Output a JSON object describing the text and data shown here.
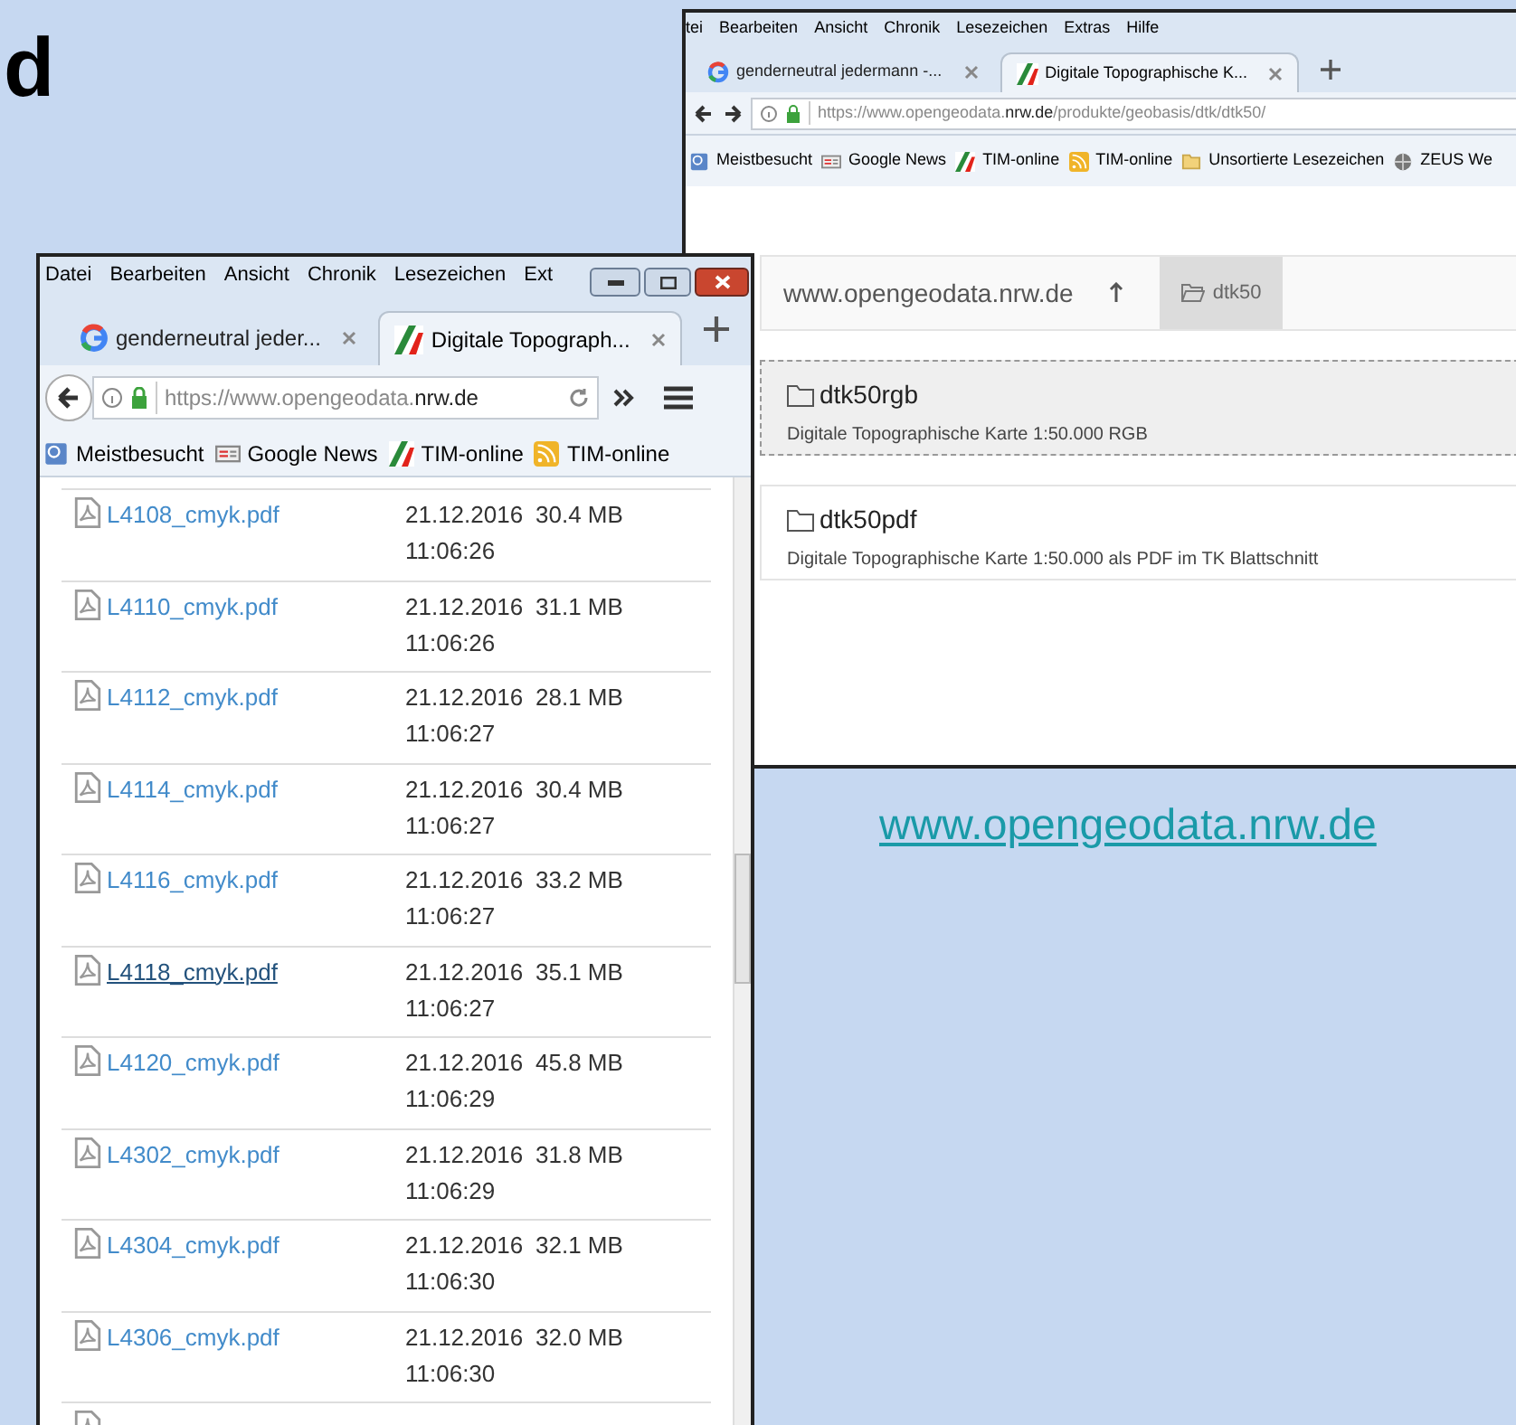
{
  "slide": {
    "title": "d",
    "link": "www.opengeodata.nrw.de"
  },
  "back_window": {
    "menu": [
      "tei",
      "Bearbeiten",
      "Ansicht",
      "Chronik",
      "Lesezeichen",
      "Extras",
      "Hilfe"
    ],
    "tabs": [
      {
        "label": "genderneutral jedermann -...",
        "selected": false
      },
      {
        "label": "Digitale Topographische K...",
        "selected": true
      }
    ],
    "url": {
      "prefix": "https://www.opengeodata.",
      "domain": "nrw.de",
      "path": "/produkte/geobasis/dtk/dtk50/"
    },
    "bookmarks": [
      "Meistbesucht",
      "Google News",
      "TIM-online",
      "TIM-online",
      "Unsortierte Lesezeichen",
      "ZEUS We"
    ],
    "breadcrumb": {
      "site": "www.opengeodata.nrw.de",
      "current": "dtk50"
    },
    "folders": [
      {
        "name": "dtk50rgb",
        "description": "Digitale Topographische Karte 1:50.000 RGB",
        "selected": true
      },
      {
        "name": "dtk50pdf",
        "description": "Digitale Topographische Karte 1:50.000 als PDF im TK Blattschnitt",
        "selected": false
      }
    ]
  },
  "front_window": {
    "menu": [
      "Datei",
      "Bearbeiten",
      "Ansicht",
      "Chronik",
      "Lesezeichen",
      "Ext"
    ],
    "tabs": [
      {
        "label": "genderneutral jeder...",
        "selected": false
      },
      {
        "label": "Digitale Topograph...",
        "selected": true
      }
    ],
    "url": {
      "prefix": "https://www.opengeodata.",
      "domain": "nrw.de"
    },
    "bookmarks": [
      "Meistbesucht",
      "Google News",
      "TIM-online",
      "TIM-online"
    ],
    "files": [
      {
        "name": "L4108_cmyk.pdf",
        "date": "21.12.2016",
        "time": "11:06:26",
        "size": "30.4 MB",
        "hovered": false
      },
      {
        "name": "L4110_cmyk.pdf",
        "date": "21.12.2016",
        "time": "11:06:26",
        "size": "31.1 MB",
        "hovered": false
      },
      {
        "name": "L4112_cmyk.pdf",
        "date": "21.12.2016",
        "time": "11:06:27",
        "size": "28.1 MB",
        "hovered": false
      },
      {
        "name": "L4114_cmyk.pdf",
        "date": "21.12.2016",
        "time": "11:06:27",
        "size": "30.4 MB",
        "hovered": false
      },
      {
        "name": "L4116_cmyk.pdf",
        "date": "21.12.2016",
        "time": "11:06:27",
        "size": "33.2 MB",
        "hovered": false
      },
      {
        "name": "L4118_cmyk.pdf",
        "date": "21.12.2016",
        "time": "11:06:27",
        "size": "35.1 MB",
        "hovered": true
      },
      {
        "name": "L4120_cmyk.pdf",
        "date": "21.12.2016",
        "time": "11:06:29",
        "size": "45.8 MB",
        "hovered": false
      },
      {
        "name": "L4302_cmyk.pdf",
        "date": "21.12.2016",
        "time": "11:06:29",
        "size": "31.8 MB",
        "hovered": false
      },
      {
        "name": "L4304_cmyk.pdf",
        "date": "21.12.2016",
        "time": "11:06:30",
        "size": "32.1 MB",
        "hovered": false
      },
      {
        "name": "L4306_cmyk.pdf",
        "date": "21.12.2016",
        "time": "11:06:30",
        "size": "32.0 MB",
        "hovered": false
      }
    ]
  }
}
